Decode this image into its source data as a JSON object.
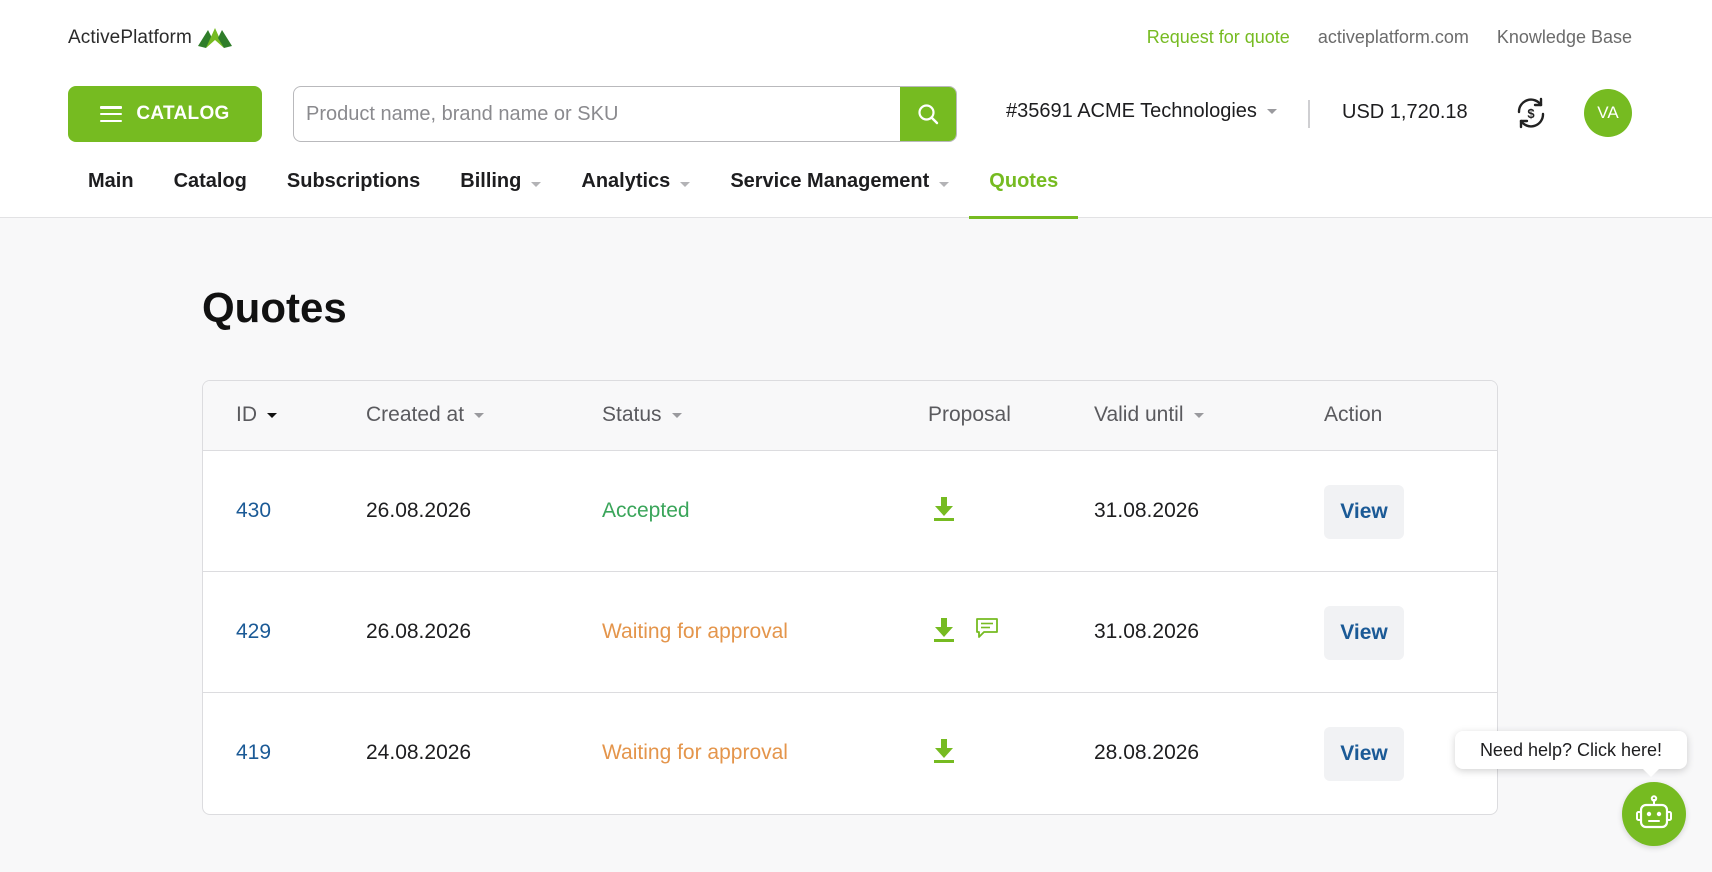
{
  "brand": {
    "name": "ActivePlatform",
    "accent": "#76bb21"
  },
  "toplinks": [
    "Request for quote",
    "activeplatform.com",
    "Knowledge Base"
  ],
  "catalog_button": {
    "label": "CATALOG",
    "icon": "menu-icon"
  },
  "search": {
    "placeholder": "Product name, brand name or SKU",
    "value": "",
    "icon": "search-icon"
  },
  "account": {
    "label": "#35691 ACME Technologies",
    "icon": "chevron-down-icon"
  },
  "balance": "USD 1,720.18",
  "sync_icon": "currency-sync-icon",
  "avatar": {
    "initials": "VA"
  },
  "nav": {
    "items": [
      {
        "label": "Main",
        "has_dropdown": false,
        "active": false
      },
      {
        "label": "Catalog",
        "has_dropdown": false,
        "active": false
      },
      {
        "label": "Subscriptions",
        "has_dropdown": false,
        "active": false
      },
      {
        "label": "Billing",
        "has_dropdown": true,
        "active": false
      },
      {
        "label": "Analytics",
        "has_dropdown": true,
        "active": false
      },
      {
        "label": "Service Management",
        "has_dropdown": true,
        "active": false
      },
      {
        "label": "Quotes",
        "has_dropdown": false,
        "active": true
      }
    ]
  },
  "page": {
    "title": "Quotes"
  },
  "table": {
    "columns": [
      {
        "label": "ID",
        "sortable": true,
        "sorted": true
      },
      {
        "label": "Created at",
        "sortable": true,
        "sorted": false
      },
      {
        "label": "Status",
        "sortable": true,
        "sorted": false
      },
      {
        "label": "Proposal",
        "sortable": false,
        "sorted": false
      },
      {
        "label": "Valid until",
        "sortable": true,
        "sorted": false
      },
      {
        "label": "Action",
        "sortable": false,
        "sorted": false
      }
    ],
    "rows": [
      {
        "id": "430",
        "created": "26.08.2026",
        "status": "Accepted",
        "status_color": "#3aa55a",
        "has_comment": false,
        "valid_until": "31.08.2026",
        "action": "View"
      },
      {
        "id": "429",
        "created": "26.08.2026",
        "status": "Waiting for approval",
        "status_color": "#e4954b",
        "has_comment": true,
        "valid_until": "31.08.2026",
        "action": "View"
      },
      {
        "id": "419",
        "created": "24.08.2026",
        "status": "Waiting for approval",
        "status_color": "#e4954b",
        "has_comment": false,
        "valid_until": "28.08.2026",
        "action": "View"
      }
    ]
  },
  "help": {
    "bubble": "Need help? Click here!",
    "icon": "robot-icon"
  }
}
